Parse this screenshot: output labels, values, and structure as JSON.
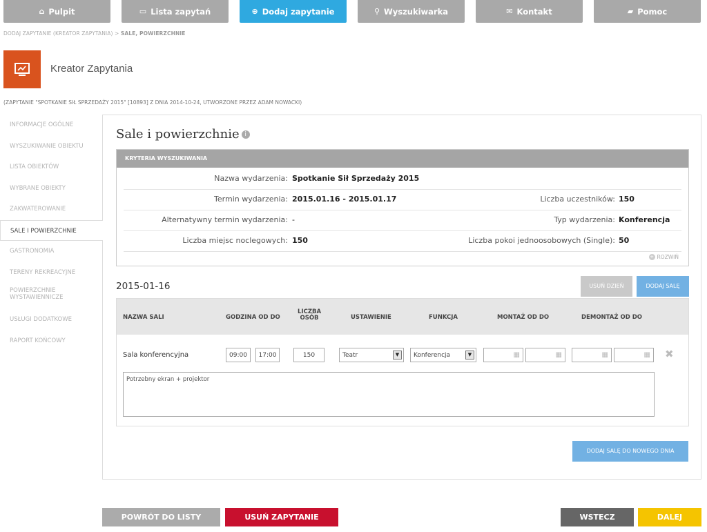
{
  "nav": {
    "items": [
      {
        "label": "Pulpit",
        "icon": "home-icon",
        "glyph": "⌂"
      },
      {
        "label": "Lista zapytań",
        "icon": "inbox-icon",
        "glyph": "▭"
      },
      {
        "label": "Dodaj zapytanie",
        "icon": "plus-circle-icon",
        "glyph": "⊕"
      },
      {
        "label": "Wyszukiwarka",
        "icon": "search-icon",
        "glyph": "⚲"
      },
      {
        "label": "Kontakt",
        "icon": "envelope-icon",
        "glyph": "✉"
      },
      {
        "label": "Pomoc",
        "icon": "book-icon",
        "glyph": "▰"
      }
    ],
    "active_color": "#2fa9e0"
  },
  "breadcrumb": {
    "prefix": "DODAJ ZAPYTANIE (KREATOR ZAPYTANIA) > ",
    "current": "SALE, POWIERZCHNIE"
  },
  "header": {
    "title": "Kreator Zapytania",
    "logo_color": "#d9531e",
    "subtitle": "(ZAPYTANIE \"SPOTKANIE SIŁ SPRZEDAŻY 2015\" [10893] Z DNIA 2014-10-24, UTWORZONE PRZEZ ADAM NOWACKI)"
  },
  "sidebar": {
    "items": [
      "INFORMACJE OGÓLNE",
      "WYSZUKIWANIE OBIEKTU",
      "LISTA OBIEKTÓW",
      "WYBRANE OBIEKTY",
      "ZAKWATEROWANIE",
      "SALE I POWIERZCHNIE",
      "GASTRONOMIA",
      "TERENY REKREACYJNE",
      "POWIERZCHNIE WYSTAWIENNICZE",
      "USŁUGI DODATKOWE",
      "RAPORT KOŃCOWY"
    ]
  },
  "main": {
    "title": "Sale i powierzchnie",
    "criteria": {
      "header": "KRYTERIA WYSZUKIWANIA",
      "event_name_label": "Nazwa wydarzenia:",
      "event_name": "Spotkanie Sił Sprzedaży 2015",
      "date_label": "Termin wydarzenia:",
      "date": "2015.01.16 - 2015.01.17",
      "participants_label": "Liczba uczestników:",
      "participants": "150",
      "alt_date_label": "Alternatywny termin wydarzenia:",
      "alt_date": "-",
      "type_label": "Typ wydarzenia:",
      "type": "Konferencja",
      "beds_label": "Liczba miejsc noclegowych:",
      "beds": "150",
      "single_label": "Liczba pokoi jednoosobowych (Single):",
      "single": "50",
      "expand": "ROZWIŃ"
    },
    "day": {
      "date": "2015-01-16",
      "remove_day": "USUŃ DZIEŃ",
      "add_room": "DODAJ SALĘ",
      "columns": [
        "NAZWA SALI",
        "GODZINA OD DO",
        "LICZBA OSÓB",
        "USTAWIENIE",
        "FUNKCJA",
        "MONTAŻ OD DO",
        "DEMONTAŻ OD DO"
      ],
      "room": {
        "name": "Sala konferencyjna",
        "time_from": "09:00",
        "time_to": "17:00",
        "people": "150",
        "setup": "Teatr",
        "function": "Konferencja",
        "note": "Potrzebny ekran + projektor"
      }
    },
    "add_room_new_day": "DODAJ SALĘ DO NOWEGO DNIA"
  },
  "footer": {
    "back_to_list": "POWRÓT DO LISTY",
    "delete_request": "USUŃ ZAPYTANIE",
    "prev": "WSTECZ",
    "next": "DALEJ"
  }
}
